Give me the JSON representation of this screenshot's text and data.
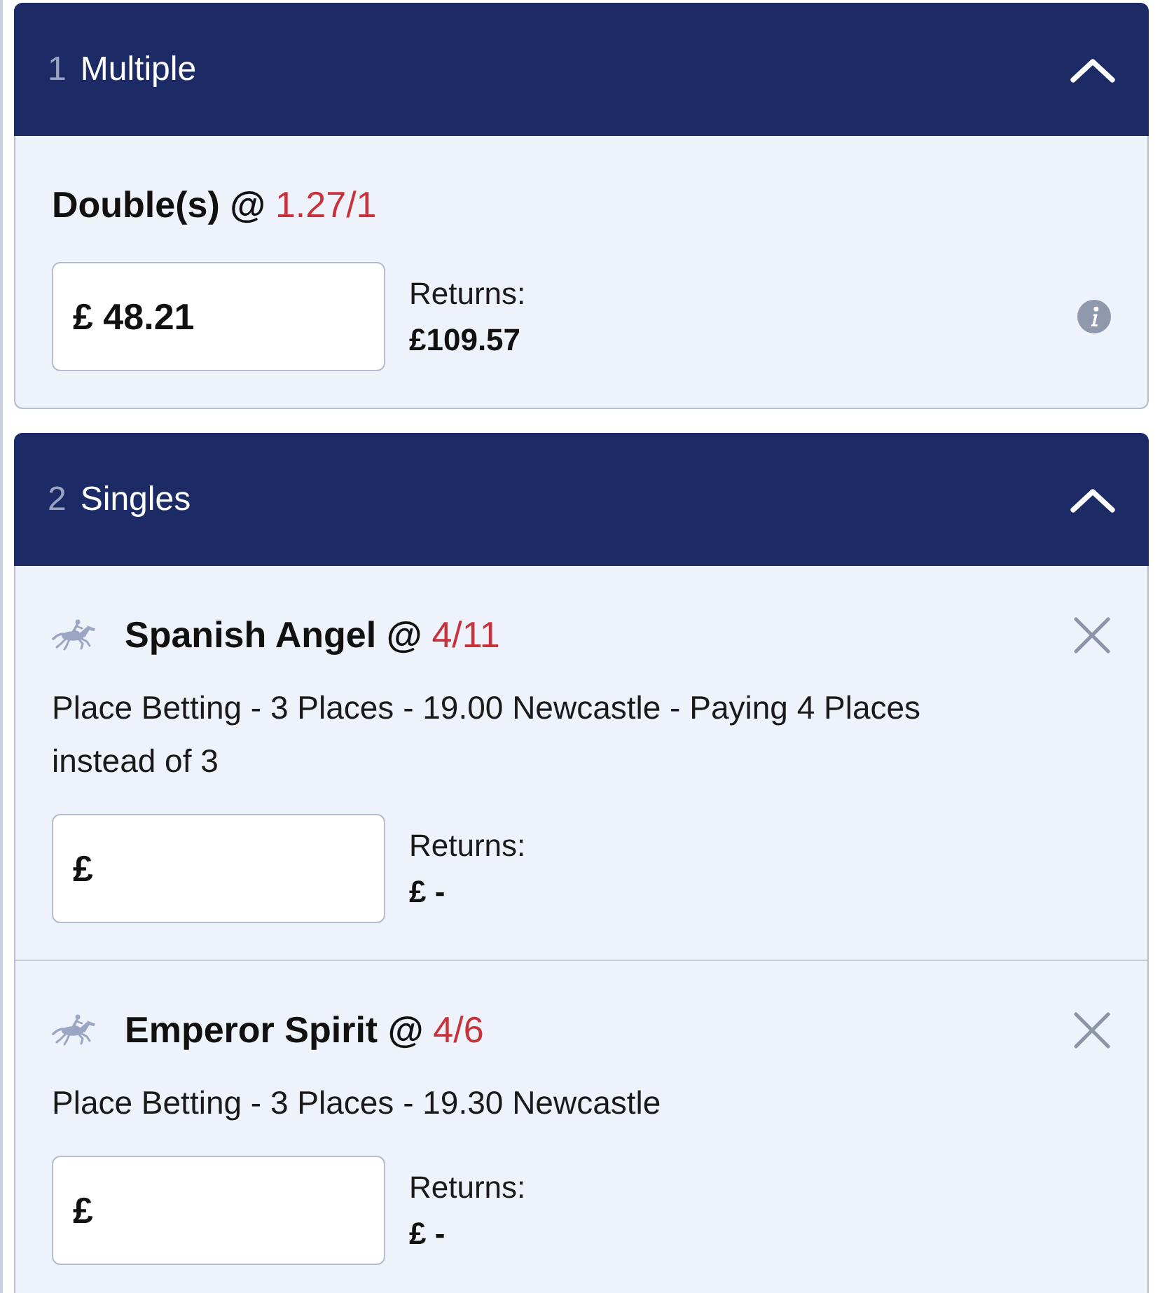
{
  "sections": [
    {
      "number": "1",
      "title": "Multiple",
      "expanded": true,
      "bets": [
        {
          "kind": "multiple",
          "name": "Double(s) @",
          "odds": "1.27/1",
          "currency": "£",
          "value": "48.21",
          "returns_label": "Returns:",
          "returns": "£109.57"
        }
      ]
    },
    {
      "number": "2",
      "title": "Singles",
      "expanded": true,
      "bets": [
        {
          "kind": "single",
          "name": "Spanish Angel @",
          "odds": "4/11",
          "description": "Place Betting - 3 Places - 19.00 Newcastle - Paying 4 Places instead of 3",
          "currency": "£",
          "returns_label": "Returns:",
          "returns": "£ -"
        },
        {
          "kind": "single",
          "name": "Emperor Spirit @",
          "odds": "4/6",
          "description": "Place Betting - 3 Places - 19.30 Newcastle",
          "currency": "£",
          "returns_label": "Returns:",
          "returns": "£ -"
        }
      ]
    }
  ]
}
